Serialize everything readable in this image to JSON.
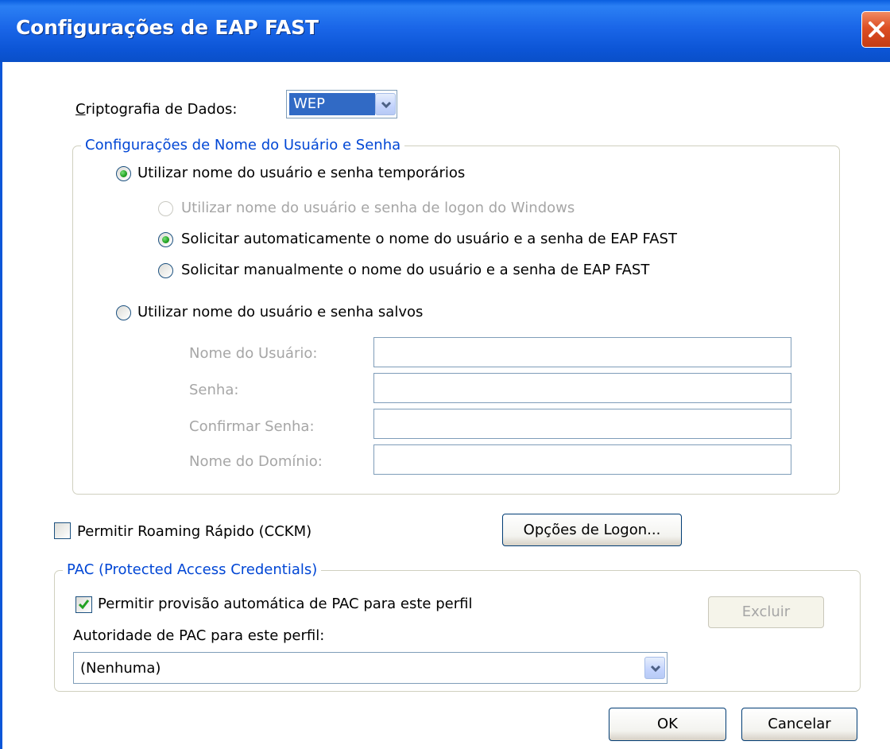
{
  "window": {
    "title": "Configurações de EAP FAST"
  },
  "encryption": {
    "label": "Criptografia de Dados:",
    "value": "WEP"
  },
  "credentials_group": {
    "legend": "Configurações de Nome do Usuário e Senha",
    "temp_option": "Utilizar nome do usuário e senha temporários",
    "windows_logon_option": "Utilizar nome do usuário e senha de logon do Windows",
    "auto_prompt_option": "Solicitar automaticamente o nome do usuário e a senha de EAP FAST",
    "manual_prompt_option": "Solicitar manualmente o nome do usuário e a senha de EAP FAST",
    "saved_option": "Utilizar nome do usuário e senha salvos",
    "username_label": "Nome do Usuário:",
    "password_label": "Senha:",
    "confirm_password_label": "Confirmar Senha:",
    "domain_label": "Nome do Domínio:",
    "username_value": "",
    "password_value": "",
    "confirm_password_value": "",
    "domain_value": ""
  },
  "fast_roaming": {
    "label": "Permitir Roaming Rápido (CCKM)",
    "checked": false
  },
  "logon_options_button": "Opções de Logon...",
  "pac_group": {
    "legend": "PAC (Protected Access Credentials)",
    "auto_provision_label": "Permitir provisão automática de PAC para este perfil",
    "auto_provision_checked": true,
    "delete_button": "Excluir",
    "authority_label": "Autoridade de PAC para este perfil:",
    "authority_value": "(Nenhuma)"
  },
  "buttons": {
    "ok": "OK",
    "cancel": "Cancelar"
  },
  "colors": {
    "title_bar": "#0a5ee0",
    "group_legend": "#0046d5",
    "radio_dot": "#21a121",
    "close_button": "#dd4f24"
  }
}
